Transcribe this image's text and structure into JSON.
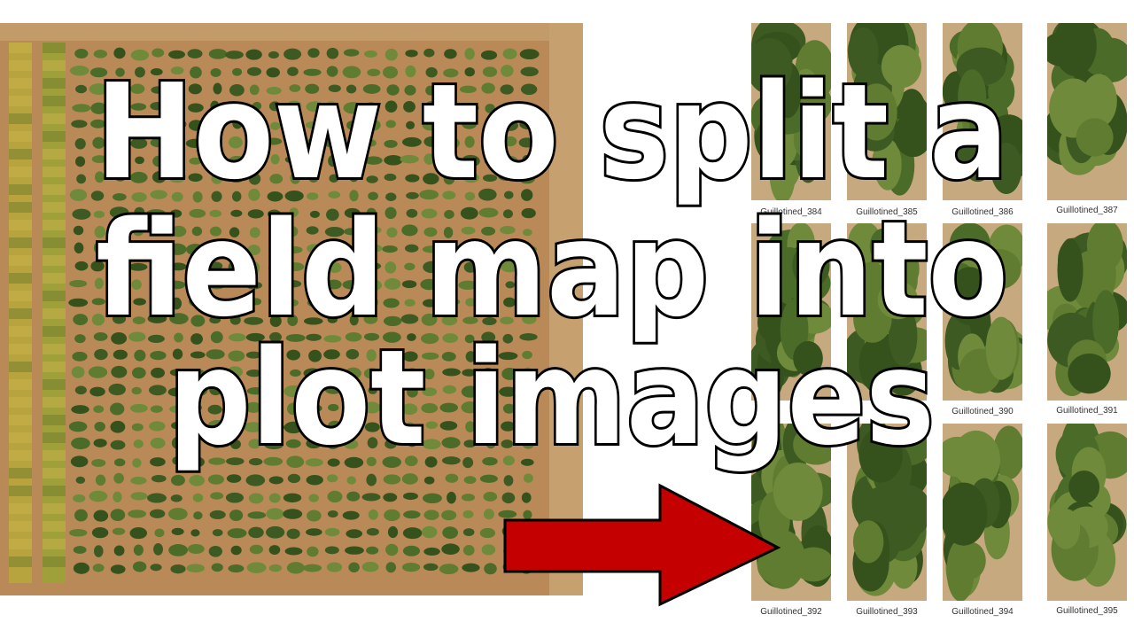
{
  "headline": {
    "lines": [
      "How to split a",
      "field map into",
      "plot images"
    ]
  },
  "tiles": [
    {
      "label": "Guillotined_384"
    },
    {
      "label": "Guillotined_385"
    },
    {
      "label": "Guillotined_386"
    },
    {
      "label": "Guillotined_387"
    },
    {
      "label": ""
    },
    {
      "label": ""
    },
    {
      "label": "Guillotined_390"
    },
    {
      "label": "Guillotined_391"
    },
    {
      "label": "Guillotined_392"
    },
    {
      "label": "Guillotined_393"
    },
    {
      "label": "Guillotined_394"
    },
    {
      "label": "Guillotined_395"
    }
  ],
  "colors": {
    "soil": "#b98a57",
    "plant_dark": "#3d5a22",
    "plant_mid": "#5f7c30",
    "arrow_fill": "#c40000",
    "text_fill": "#ffffff",
    "text_stroke": "#000000"
  },
  "icons": {
    "arrow": "right-arrow-icon"
  }
}
